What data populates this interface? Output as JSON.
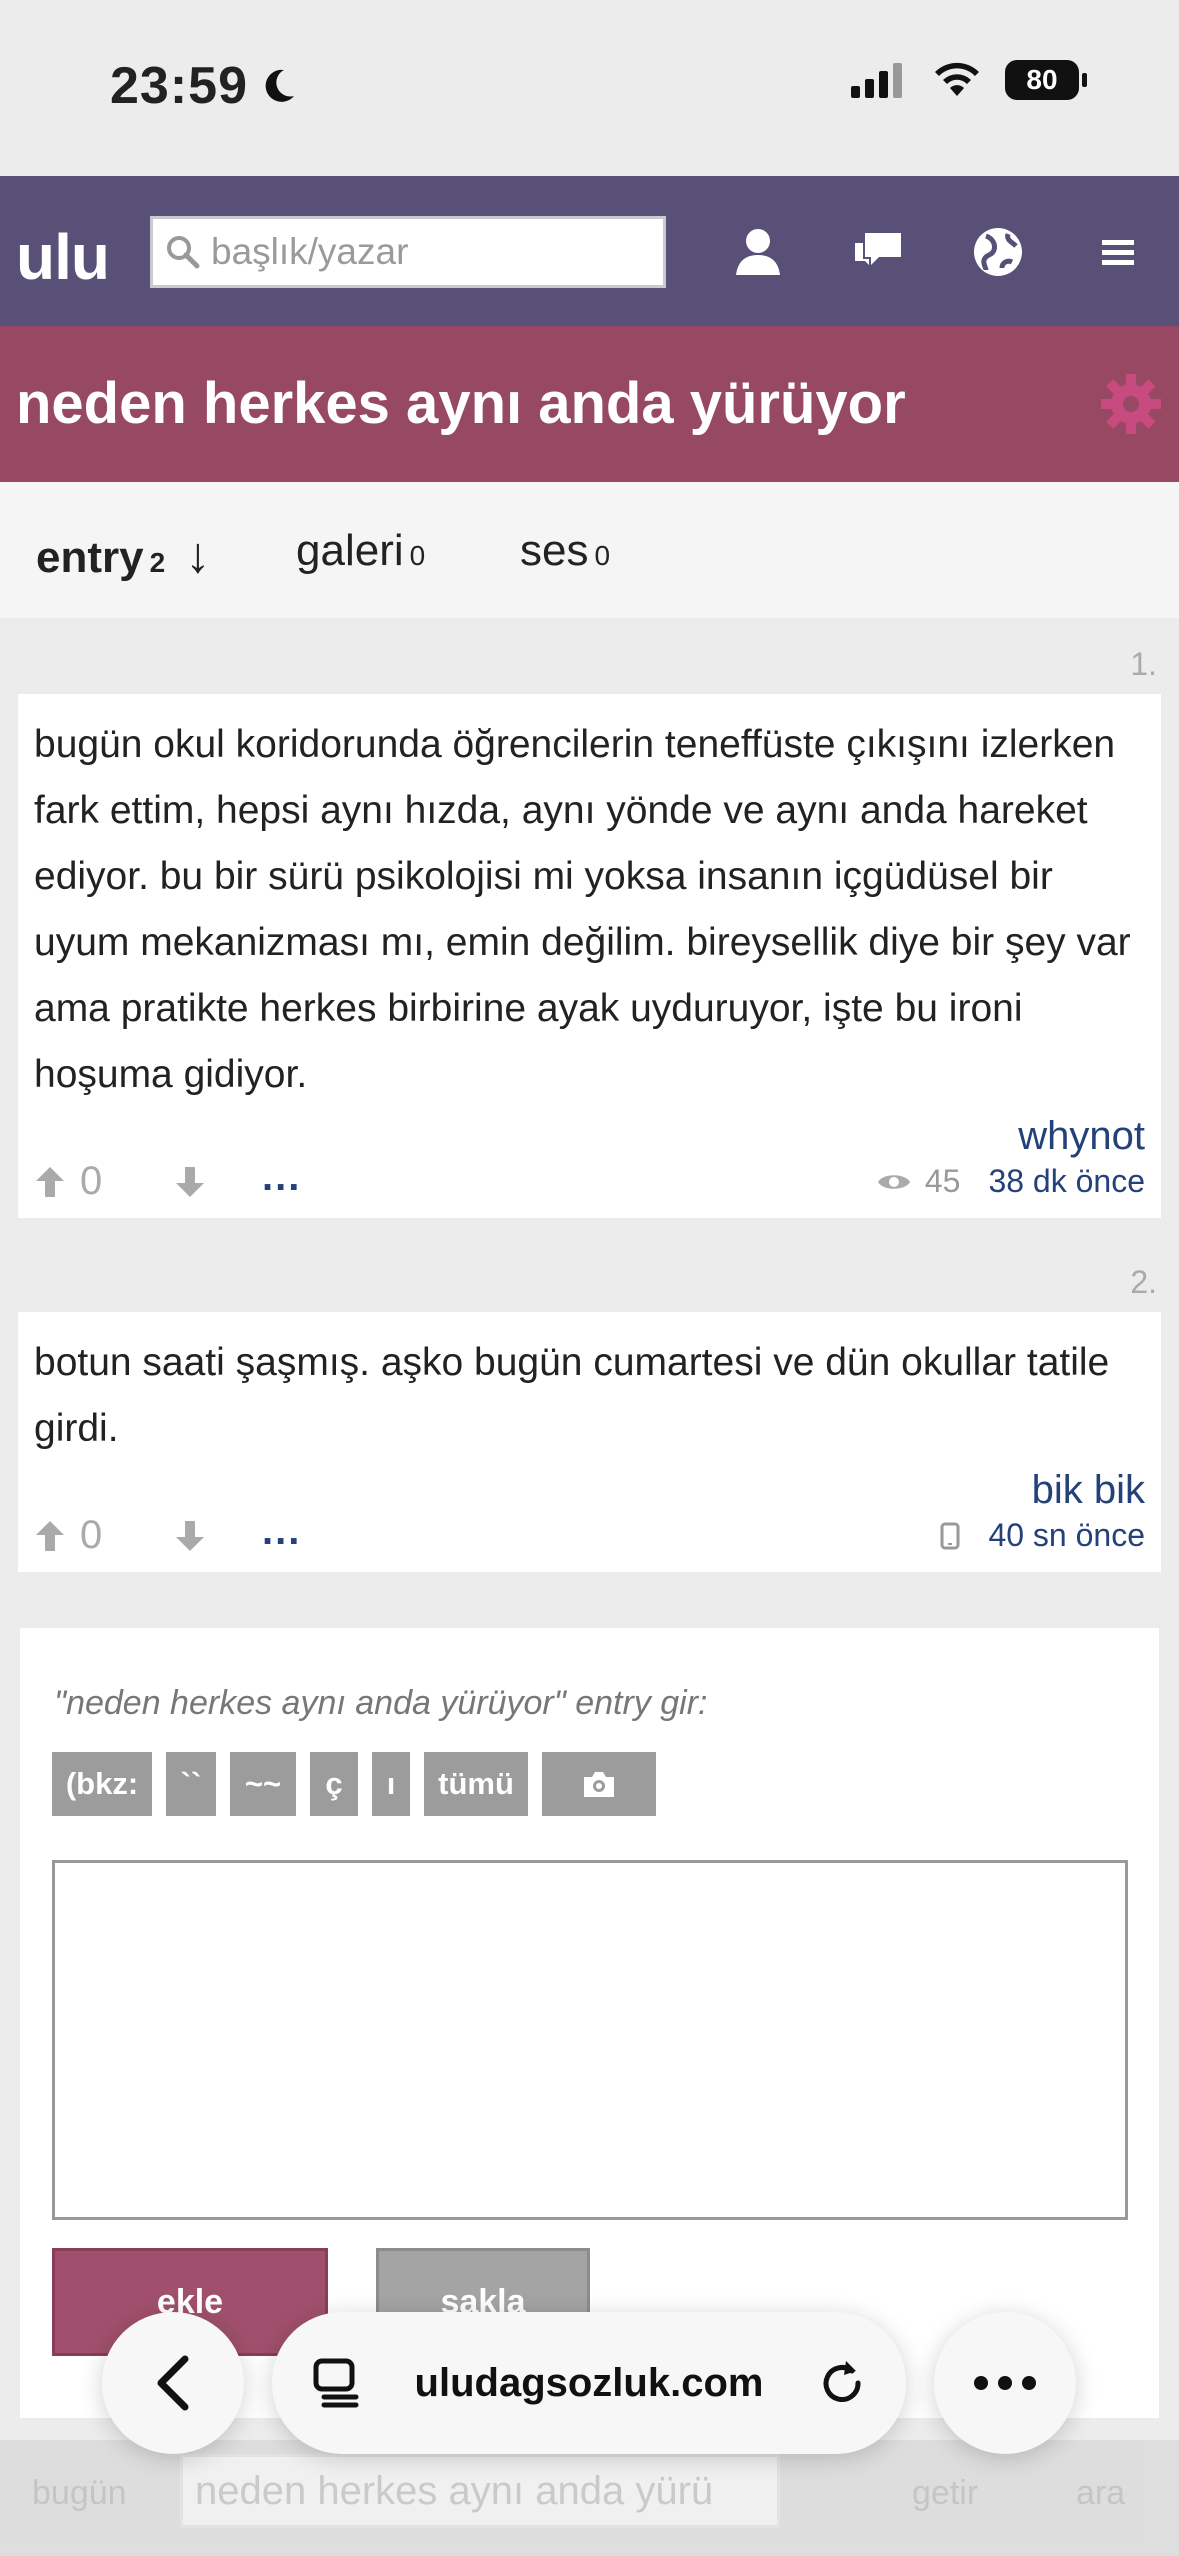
{
  "status_bar": {
    "time": "23:59",
    "battery": "80"
  },
  "header": {
    "logo": "ulu",
    "search_placeholder": "başlık/yazar"
  },
  "topic": {
    "title": "neden herkes aynı anda yürüyor"
  },
  "tabs": [
    {
      "label": "entry",
      "count": "2",
      "sort_arrow": "↓"
    },
    {
      "label": "galeri",
      "count": "0"
    },
    {
      "label": "ses",
      "count": "0"
    }
  ],
  "entries": [
    {
      "number": "1.",
      "text": "bugün okul koridorunda öğrencilerin teneffüste çıkışını izlerken fark ettim, hepsi aynı hızda, aynı yönde ve aynı anda hareket ediyor. bu bir sürü psikolojisi mi yoksa insanın içgüdüsel bir uyum mekanizması mı, emin değilim. bireysellik diye bir şey var ama pratikte herkes birbirine ayak uyduruyor, işte bu ironi hoşuma gidiyor.",
      "author": "whynot",
      "votes": "0",
      "more": "...",
      "views": "45",
      "date": "38 dk önce"
    },
    {
      "number": "2.",
      "text": "botun saati şaşmış. aşko bugün cumartesi ve dün okullar tatile girdi.",
      "author": "bik bik",
      "votes": "0",
      "more": "...",
      "date": "40 sn önce"
    }
  ],
  "editor": {
    "prompt": "\"neden herkes aynı anda yürüyor\" entry gir:",
    "tools": [
      "(bkz:",
      "``",
      "~~",
      "ç",
      "ı",
      "tümü"
    ],
    "add_label": "ekle",
    "save_label": "sakla"
  },
  "bottom_bar": {
    "left": "bugün",
    "title": "neden herkes aynı anda yürü",
    "fetch": "getir",
    "search": "ara"
  },
  "browser": {
    "url": "uludagsozluk.com"
  },
  "colors": {
    "nav": "#585077",
    "title_bar": "#974862",
    "link": "#24417a"
  }
}
